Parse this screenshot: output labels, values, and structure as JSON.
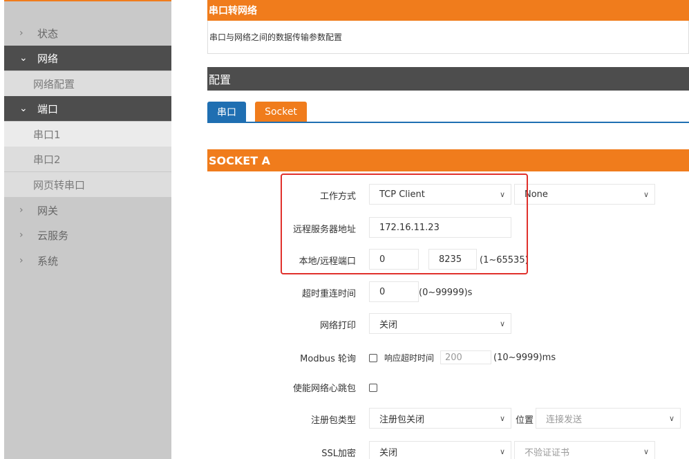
{
  "sidebar": {
    "items": [
      {
        "label": "状态"
      },
      {
        "label": "网络"
      },
      {
        "label": "网络配置"
      },
      {
        "label": "端口"
      },
      {
        "label": "串口1"
      },
      {
        "label": "串口2"
      },
      {
        "label": "网页转串口"
      },
      {
        "label": "网关"
      },
      {
        "label": "云服务"
      },
      {
        "label": "系统"
      }
    ]
  },
  "header": {
    "title": "串口转网络",
    "description": "串口与网络之间的数据传输参数配置"
  },
  "config": {
    "title": "配置",
    "tabs": [
      {
        "label": "串口",
        "color": "#1f6fb2"
      },
      {
        "label": "Socket",
        "color": "#f07c1c"
      }
    ]
  },
  "socket": {
    "title": "SOCKET A",
    "work_mode": {
      "label": "工作方式",
      "value": "TCP Client",
      "secondary": "None"
    },
    "remote_addr": {
      "label": "远程服务器地址",
      "value": "172.16.11.23"
    },
    "ports": {
      "label": "本地/远程端口",
      "local": "0",
      "remote": "8235",
      "range": "(1~65535)"
    },
    "reconnect": {
      "label": "超时重连时间",
      "value": "0",
      "range": "(0~99999)s"
    },
    "net_print": {
      "label": "网络打印",
      "value": "关闭"
    },
    "modbus": {
      "label": "Modbus 轮询",
      "timeout_label": "响应超时时间",
      "timeout_value": "200",
      "range": "(10~9999)ms"
    },
    "heartbeat": {
      "label": "使能网络心跳包"
    },
    "register": {
      "label": "注册包类型",
      "value": "注册包关闭",
      "position_label": "位置",
      "position_value": "连接发送"
    },
    "ssl": {
      "label": "SSL加密",
      "value": "关闭",
      "cert_value": "不验证证书"
    }
  },
  "colors": {
    "accent": "#f07c1c",
    "dark": "#4d4d4d",
    "tab_blue": "#1f6fb2",
    "highlight": "#e0302b"
  }
}
